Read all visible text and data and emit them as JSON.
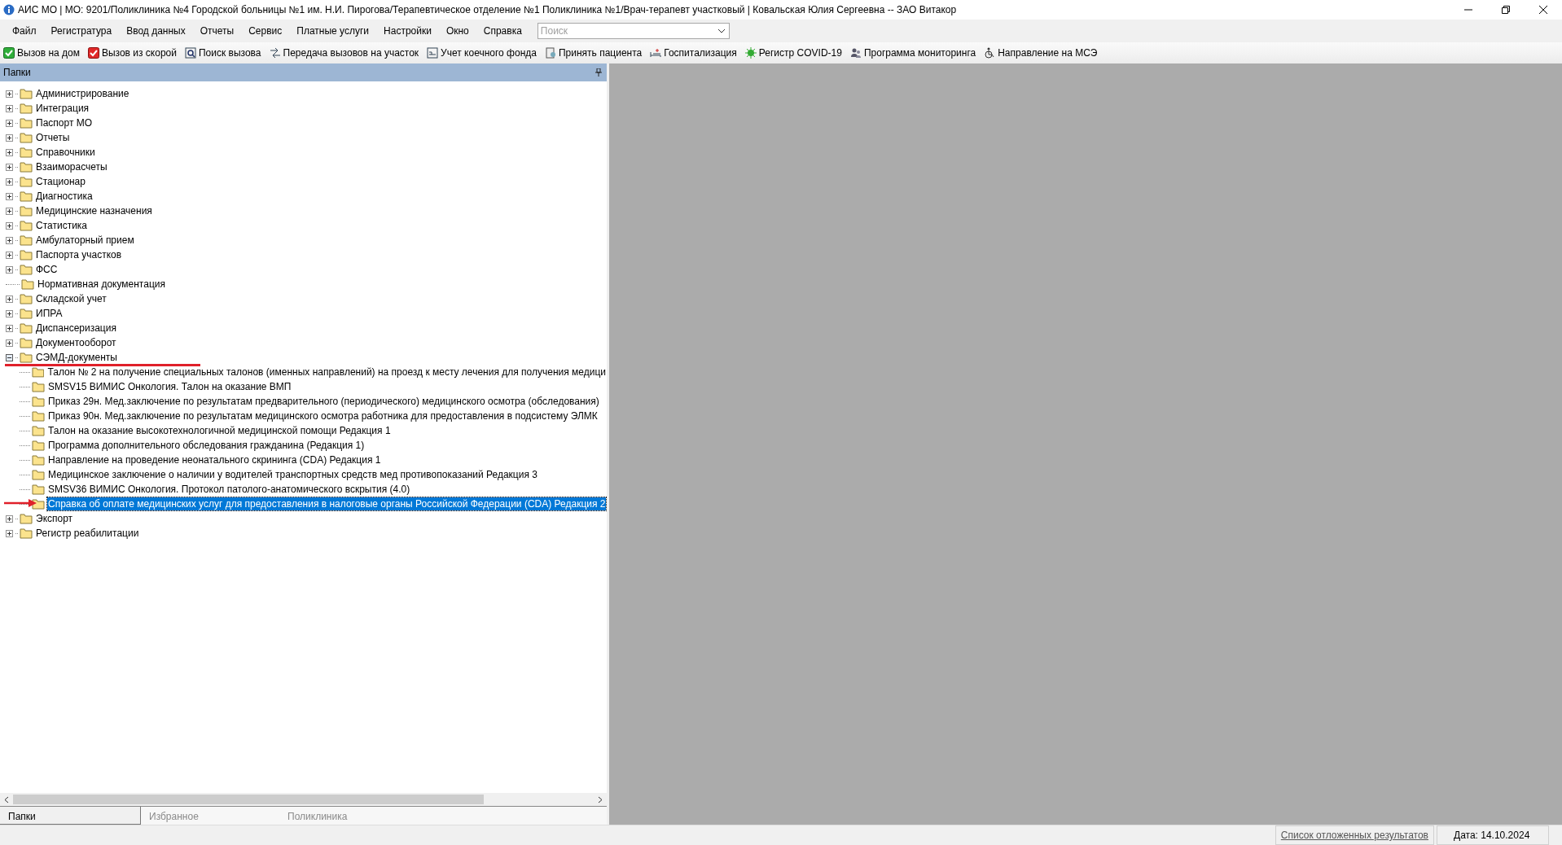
{
  "window": {
    "title": "АИС МО | МО: 9201/Поликлиника №4 Городской больницы №1 им. Н.И. Пирогова/Терапевтическое отделение №1 Поликлиника №1/Врач-терапевт участковый | Ковальская Юлия Сергеевна -- ЗАО Витакор"
  },
  "menu": [
    "Файл",
    "Регистратура",
    "Ввод данных",
    "Отчеты",
    "Сервис",
    "Платные услуги",
    "Настройки",
    "Окно",
    "Справка"
  ],
  "search": {
    "placeholder": "Поиск"
  },
  "toolbar": [
    "Вызов на дом",
    "Вызов из скорой",
    "Поиск вызова",
    "Передача вызовов на участок",
    "Учет коечного фонда",
    "Принять пациента",
    "Госпитализация",
    "Регистр COVID-19",
    "Программа мониторинга",
    "Направление на МСЭ"
  ],
  "panel": {
    "title": "Папки"
  },
  "tree": [
    {
      "label": "Администрирование",
      "kind": "branch",
      "expanded": false,
      "selected": false
    },
    {
      "label": "Интеграция",
      "kind": "branch",
      "expanded": false,
      "selected": false
    },
    {
      "label": "Паспорт МО",
      "kind": "branch",
      "expanded": false,
      "selected": false
    },
    {
      "label": "Отчеты",
      "kind": "branch",
      "expanded": false,
      "selected": false
    },
    {
      "label": "Справочники",
      "kind": "branch",
      "expanded": false,
      "selected": false
    },
    {
      "label": "Взаиморасчеты",
      "kind": "branch",
      "expanded": false,
      "selected": false
    },
    {
      "label": "Стационар",
      "kind": "branch",
      "expanded": false,
      "selected": false
    },
    {
      "label": "Диагностика",
      "kind": "branch",
      "expanded": false,
      "selected": false
    },
    {
      "label": "Медицинские назначения",
      "kind": "branch",
      "expanded": false,
      "selected": false
    },
    {
      "label": "Статистика",
      "kind": "branch",
      "expanded": false,
      "selected": false
    },
    {
      "label": "Амбулаторный прием",
      "kind": "branch",
      "expanded": false,
      "selected": false
    },
    {
      "label": "Паспорта участков",
      "kind": "branch",
      "expanded": false,
      "selected": false
    },
    {
      "label": "ФСС",
      "kind": "branch",
      "expanded": false,
      "selected": false
    },
    {
      "label": "Нормативная документация",
      "kind": "leaf",
      "selected": false
    },
    {
      "label": "Складской учет",
      "kind": "branch",
      "expanded": false,
      "selected": false
    },
    {
      "label": "ИПРА",
      "kind": "branch",
      "expanded": false,
      "selected": false
    },
    {
      "label": "Диспансеризация",
      "kind": "branch",
      "expanded": false,
      "selected": false
    },
    {
      "label": "Документооборот",
      "kind": "branch",
      "expanded": false,
      "selected": false
    },
    {
      "label": "СЭМД-документы",
      "kind": "branch",
      "expanded": true,
      "selected": false,
      "children": [
        {
          "label": "Талон № 2 на получение специальных талонов (именных направлений) на проезд к месту лечения для получения медици",
          "selected": false
        },
        {
          "label": "SMSV15 ВИМИС Онкология. Талон на оказание ВМП",
          "selected": false
        },
        {
          "label": "Приказ 29н. Мед.заключение по результатам предварительного (периодического) медицинского осмотра (обследования)",
          "selected": false
        },
        {
          "label": "Приказ 90н. Мед.заключение по результатам медицинского осмотра работника для предоставления в подсистему ЭЛМК",
          "selected": false
        },
        {
          "label": "Талон на оказание высокотехнологичной медицинской помощи Редакция 1",
          "selected": false
        },
        {
          "label": "Программа дополнительного обследования гражданина (Редакция 1)",
          "selected": false
        },
        {
          "label": "Направление на проведение неонатального скрининга (CDA) Редакция 1",
          "selected": false
        },
        {
          "label": "Медицинское заключение о наличии у водителей транспортных средств мед противопоказаний Редакция 3",
          "selected": false
        },
        {
          "label": "SMSV36 ВИМИС Онкология. Протокол патолого-анатомического вскрытия (4.0)",
          "selected": false
        },
        {
          "label": "Справка об оплате медицинских услуг для предоставления в налоговые органы Российской Федерации (CDA) Редакция 2",
          "selected": true
        }
      ]
    },
    {
      "label": "Экспорт",
      "kind": "branch",
      "expanded": false,
      "selected": false
    },
    {
      "label": "Регистр реабилитации",
      "kind": "branch",
      "expanded": false,
      "selected": false
    }
  ],
  "bottom_tabs": [
    {
      "label": "Папки",
      "selected": true
    },
    {
      "label": "Избранное",
      "selected": false
    },
    {
      "label": "Поликлиника",
      "selected": false
    }
  ],
  "status_bar": {
    "link": "Список отложенных результатов",
    "date": "Дата: 14.10.2024"
  }
}
